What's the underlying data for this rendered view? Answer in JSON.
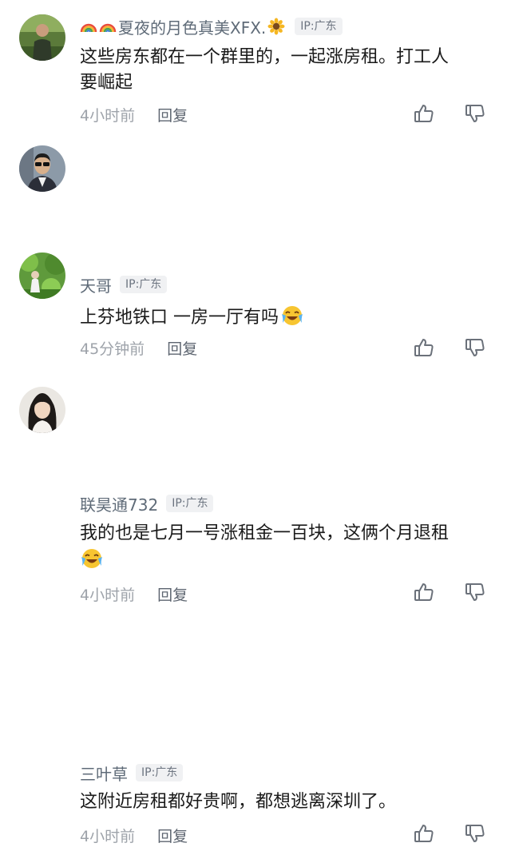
{
  "comments": [
    {
      "username": "夏夜的月色真美XFX.",
      "decorations": [
        "rainbow-emoji",
        "rainbow-emoji",
        "sunflower-emoji"
      ],
      "ip": "IP:广东",
      "text": "这些房东都在一个群里的，一起涨房租。打工人要崛起",
      "text_line1": "这些房东都在一个群里的，一起涨房租。打工人",
      "text_line2": "要崛起",
      "time": "4小时前",
      "reply": "回复"
    },
    {
      "username": "天哥",
      "ip": "IP:广东",
      "text": "上芬地铁口 一房一厅有吗",
      "emoji": "laughing-crying-emoji",
      "time": "45分钟前",
      "reply": "回复"
    },
    {
      "username": "联昊通732",
      "ip": "IP:广东",
      "text": "我的也是七月一号涨租金一百块，这俩个月退租",
      "emoji": "laughing-crying-emoji",
      "time": "4小时前",
      "reply": "回复"
    },
    {
      "username": "三叶草",
      "ip": "IP:广东",
      "text": "这附近房租都好贵啊，都想逃离深圳了。",
      "time": "4小时前",
      "reply": "回复"
    }
  ],
  "colors": {
    "username": "#5f6b78",
    "ip_badge_bg": "#f0f1f3",
    "meta": "#9ea3aa",
    "icon": "#6b717a"
  },
  "icons": [
    "thumbs-up-icon",
    "thumbs-down-icon"
  ]
}
